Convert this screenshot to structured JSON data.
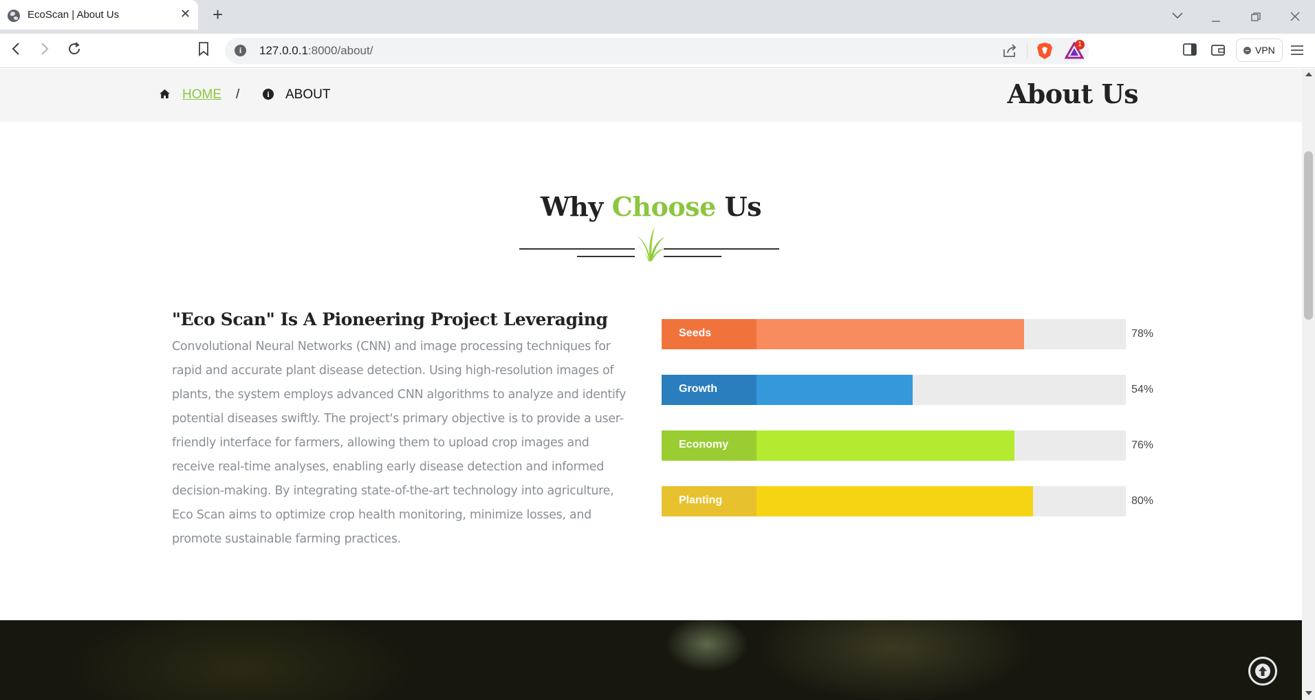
{
  "browser": {
    "tab_title": "EcoScan | About Us",
    "url_host": "127.0.0.1",
    "url_path": ":8000/about/",
    "vpn_label": "VPN",
    "rewards_badge": "1"
  },
  "breadcrumb": {
    "home_label": "HOME",
    "separator": "/",
    "current_label": "ABOUT",
    "home_icon": "home-icon",
    "info_icon": "info-circle-icon"
  },
  "header": {
    "page_title": "About Us"
  },
  "section": {
    "title_part1": "Why ",
    "title_accent": "Choose",
    "title_part2": " Us",
    "accent_color": "#8cc63f"
  },
  "about": {
    "heading": "\"Eco Scan\" Is A Pioneering Project Leveraging",
    "body": "Convolutional Neural Networks (CNN) and image processing techniques for rapid and accurate plant disease detection. Using high-resolution images of plants, the system employs advanced CNN algorithms to analyze and identify potential diseases swiftly. The project's primary objective is to provide a user-friendly interface for farmers, allowing them to upload crop images and receive real-time analyses, enabling early disease detection and informed decision-making. By integrating state-of-the-art technology into agriculture, Eco Scan aims to optimize crop health monitoring, minimize losses, and promote sustainable farming practices."
  },
  "skills": [
    {
      "name": "Seeds",
      "percent": 78,
      "percent_label": "78%",
      "tag_color": "#f1733c",
      "bar_color": "#f98c5f"
    },
    {
      "name": "Growth",
      "percent": 54,
      "percent_label": "54%",
      "tag_color": "#2a7ebd",
      "bar_color": "#3498db"
    },
    {
      "name": "Economy",
      "percent": 76,
      "percent_label": "76%",
      "tag_color": "#9acd32",
      "bar_color": "#b2eb2f"
    },
    {
      "name": "Planting",
      "percent": 80,
      "percent_label": "80%",
      "tag_color": "#e8c22e",
      "bar_color": "#f5d414"
    }
  ]
}
